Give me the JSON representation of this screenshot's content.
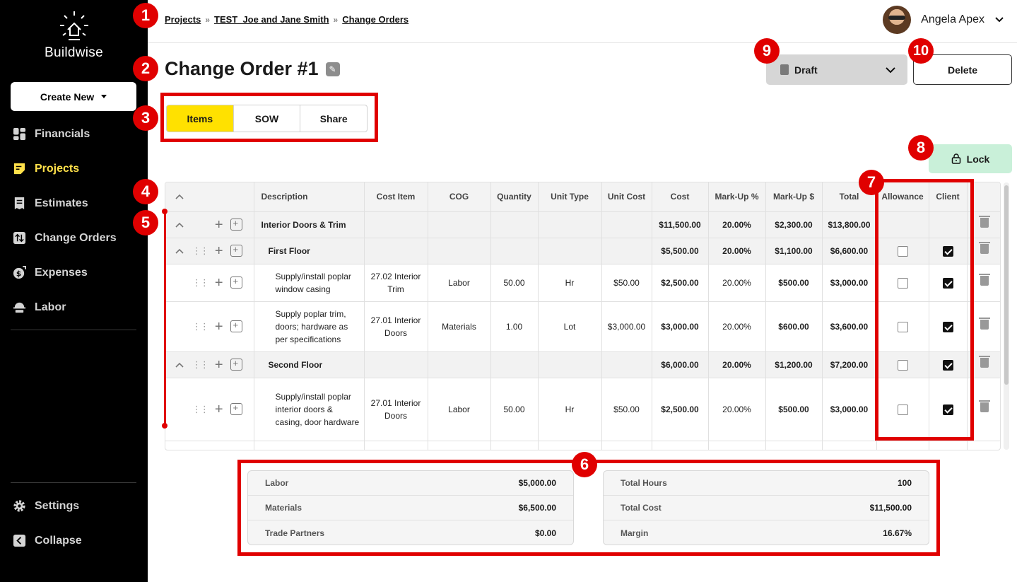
{
  "sidebar": {
    "brand": "Buildwise",
    "create_new": "Create New",
    "items": [
      {
        "label": "Financials",
        "icon": "dashboard-icon",
        "active": false
      },
      {
        "label": "Projects",
        "icon": "projects-icon",
        "active": true
      },
      {
        "label": "Estimates",
        "icon": "estimates-icon",
        "active": false
      },
      {
        "label": "Change Orders",
        "icon": "change-orders-icon",
        "active": false
      },
      {
        "label": "Expenses",
        "icon": "expenses-icon",
        "active": false
      },
      {
        "label": "Labor",
        "icon": "labor-icon",
        "active": false
      }
    ],
    "bottom": [
      {
        "label": "Settings",
        "icon": "gear-icon"
      },
      {
        "label": "Collapse",
        "icon": "collapse-icon"
      }
    ]
  },
  "header": {
    "breadcrumb": [
      "Projects",
      "TEST_Joe and Jane Smith",
      "Change Orders"
    ],
    "user_name": "Angela Apex"
  },
  "page": {
    "title": "Change Order #1",
    "status": "Draft",
    "delete": "Delete",
    "lock": "Lock",
    "tabs": [
      "Items",
      "SOW",
      "Share"
    ]
  },
  "table": {
    "columns": [
      "Description",
      "Cost Item",
      "COG",
      "Quantity",
      "Unit Type",
      "Unit Cost",
      "Cost",
      "Mark-Up %",
      "Mark-Up $",
      "Total",
      "Allowance",
      "Client"
    ],
    "rows": [
      {
        "kind": "group",
        "desc": "Interior Doors & Trim",
        "cost_item": "",
        "cog": "",
        "qty": "",
        "unit": "",
        "unit_cost": "",
        "cost": "$11,500.00",
        "markup_pct": "20.00%",
        "markup_amt": "$2,300.00",
        "total": "$13,800.00"
      },
      {
        "kind": "sub",
        "desc": "First Floor",
        "cost_item": "",
        "cog": "",
        "qty": "",
        "unit": "",
        "unit_cost": "",
        "cost": "$5,500.00",
        "markup_pct": "20.00%",
        "markup_amt": "$1,100.00",
        "total": "$6,600.00"
      },
      {
        "kind": "item",
        "desc": "Supply/install poplar window casing",
        "cost_item": "27.02 Interior Trim",
        "cog": "Labor",
        "qty": "50.00",
        "unit": "Hr",
        "unit_cost": "$50.00",
        "cost": "$2,500.00",
        "markup_pct": "20.00%",
        "markup_amt": "$500.00",
        "total": "$3,000.00"
      },
      {
        "kind": "item",
        "desc": "Supply poplar trim, doors; hardware as per specifications",
        "cost_item": "27.01 Interior Doors",
        "cog": "Materials",
        "qty": "1.00",
        "unit": "Lot",
        "unit_cost": "$3,000.00",
        "cost": "$3,000.00",
        "markup_pct": "20.00%",
        "markup_amt": "$600.00",
        "total": "$3,600.00"
      },
      {
        "kind": "sub",
        "desc": "Second Floor",
        "cost_item": "",
        "cog": "",
        "qty": "",
        "unit": "",
        "unit_cost": "",
        "cost": "$6,000.00",
        "markup_pct": "20.00%",
        "markup_amt": "$1,200.00",
        "total": "$7,200.00"
      },
      {
        "kind": "item",
        "desc": "Supply/install poplar interior doors & casing, door hardware",
        "cost_item": "27.01 Interior Doors",
        "cog": "Labor",
        "qty": "50.00",
        "unit": "Hr",
        "unit_cost": "$50.00",
        "cost": "$2,500.00",
        "markup_pct": "20.00%",
        "markup_amt": "$500.00",
        "total": "$3,000.00"
      }
    ]
  },
  "summary": {
    "left": [
      {
        "label": "Labor",
        "value": "$5,000.00"
      },
      {
        "label": "Materials",
        "value": "$6,500.00"
      },
      {
        "label": "Trade Partners",
        "value": "$0.00"
      }
    ],
    "right": [
      {
        "label": "Total Hours",
        "value": "100"
      },
      {
        "label": "Total Cost",
        "value": "$11,500.00"
      },
      {
        "label": "Margin",
        "value": "16.67%"
      }
    ]
  },
  "annotations": [
    "1",
    "2",
    "3",
    "4",
    "5",
    "6",
    "7",
    "8",
    "9",
    "10"
  ],
  "colors": {
    "accent": "#ffe100",
    "annotation": "#e00000",
    "lock_bg": "#c9f0d9",
    "sidebar": "#000000"
  }
}
